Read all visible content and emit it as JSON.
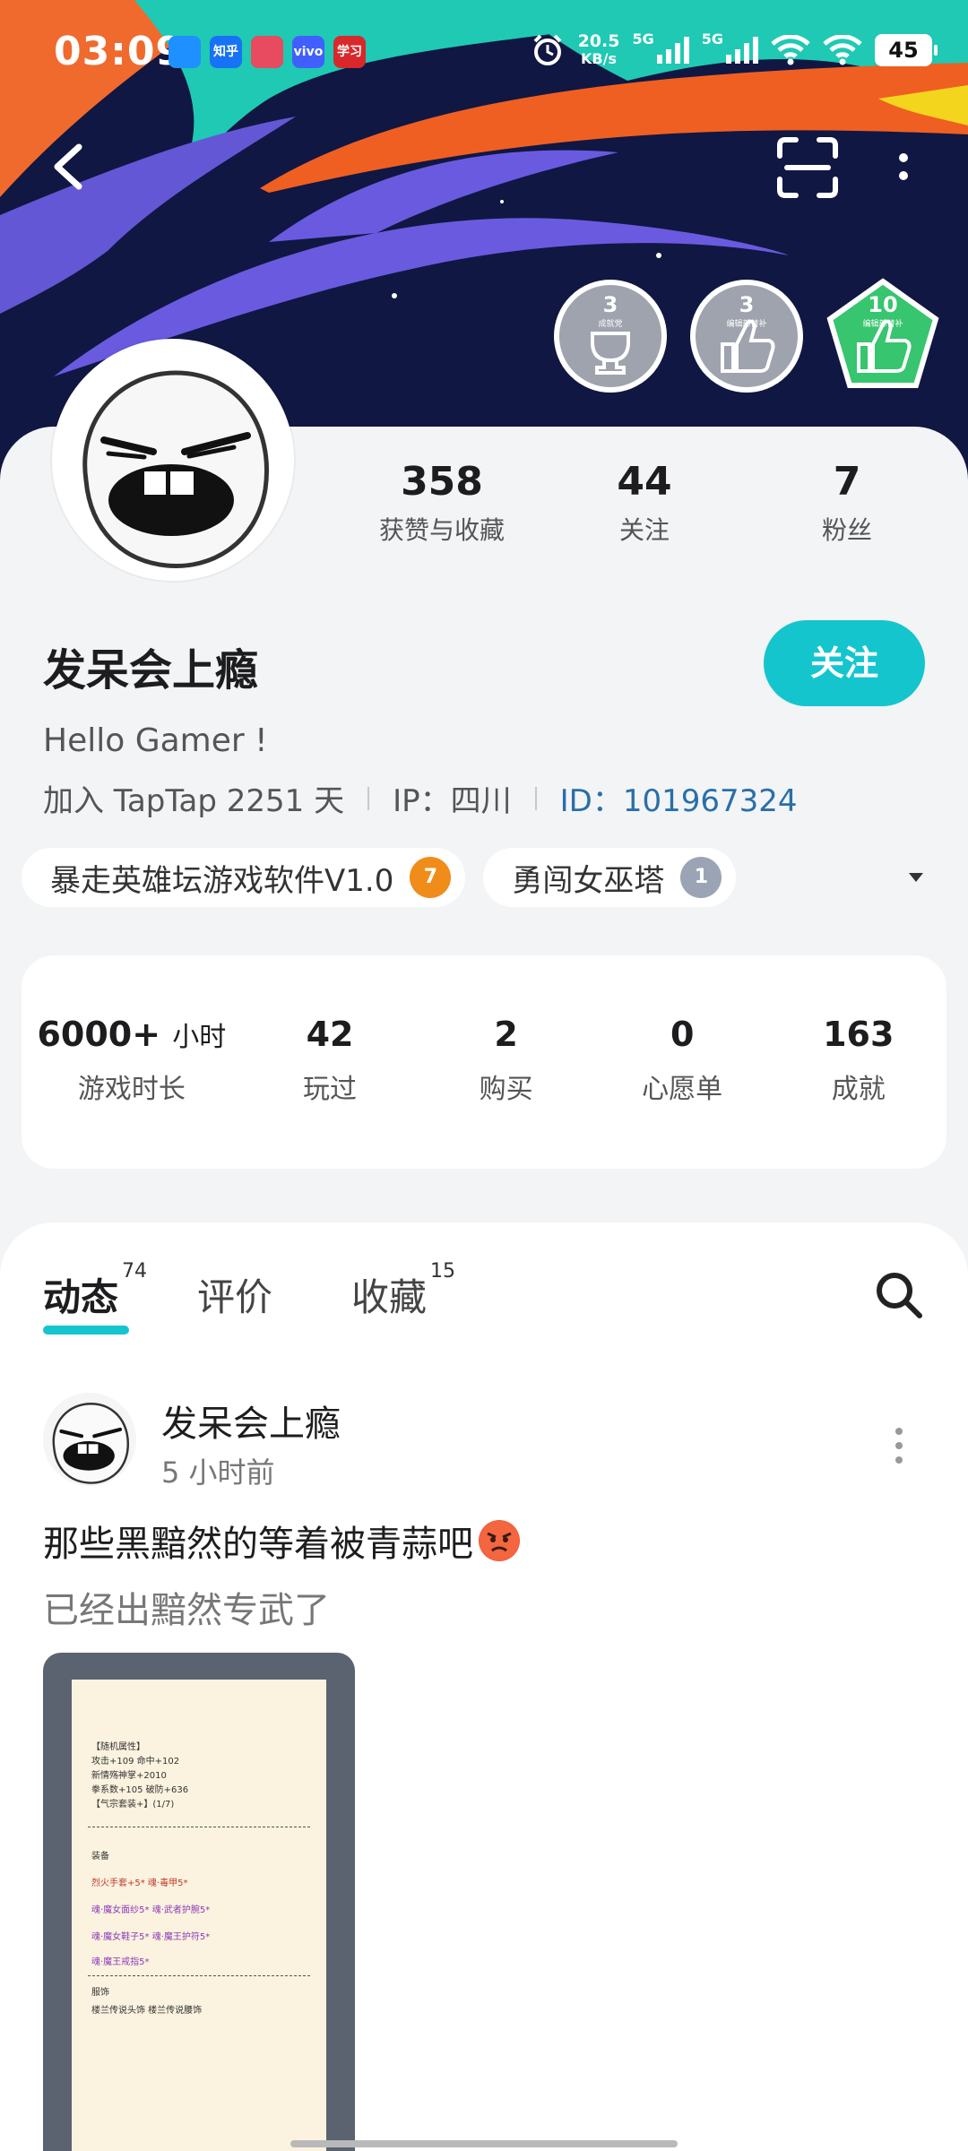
{
  "status_bar": {
    "time": "03:09",
    "app_icons": [
      {
        "name": "qq-icon",
        "text": "",
        "color": "#1e90ff"
      },
      {
        "name": "zhihu-icon",
        "text": "知乎",
        "color": "#1772f6"
      },
      {
        "name": "map-pin-app-icon",
        "text": "",
        "color": "#e84a5f"
      },
      {
        "name": "vivo-icon",
        "text": "vivo",
        "color": "#415fff"
      },
      {
        "name": "xuexi-icon",
        "text": "学习",
        "color": "#d8282b"
      }
    ],
    "net_speed": "20.5",
    "net_speed_unit": "KB/s",
    "signal1_label": "5G",
    "signal2_label": "5G",
    "battery": "45"
  },
  "badges": [
    {
      "count": "3",
      "label": "成就党",
      "color": "#9ea3ad"
    },
    {
      "count": "3",
      "label": "编辑部替补",
      "color": "#9ea3ad"
    },
    {
      "count": "10",
      "label": "编辑部替补",
      "color": "#37c56f"
    }
  ],
  "profile": {
    "stats": [
      {
        "value": "358",
        "label": "获赞与收藏"
      },
      {
        "value": "44",
        "label": "关注"
      },
      {
        "value": "7",
        "label": "粉丝"
      }
    ],
    "username": "发呆会上瘾",
    "follow_label": "关注",
    "bio": "Hello Gamer !",
    "join_text": "加入 TapTap 2251 天",
    "ip_text": "IP：四川",
    "id_text": "ID：101967324",
    "game_tags": [
      {
        "name": "暴走英雄坛游戏软件V1.0",
        "badge": "7",
        "badge_color": "#f08c1a"
      },
      {
        "name": "勇闯女巫塔",
        "badge": "1",
        "badge_color": "#9aa4b4"
      }
    ]
  },
  "game_stats": [
    {
      "value": "6000+",
      "unit": "小时",
      "label": "游戏时长"
    },
    {
      "value": "42",
      "unit": "",
      "label": "玩过"
    },
    {
      "value": "2",
      "unit": "",
      "label": "购买"
    },
    {
      "value": "0",
      "unit": "",
      "label": "心愿单"
    },
    {
      "value": "163",
      "unit": "",
      "label": "成就"
    }
  ],
  "tabs": [
    {
      "label": "动态",
      "count": "74",
      "active": true
    },
    {
      "label": "评价",
      "count": "",
      "active": false
    },
    {
      "label": "收藏",
      "count": "15",
      "active": false
    }
  ],
  "post": {
    "author": "发呆会上瘾",
    "time": "5 小时前",
    "title": "那些黑黯然的等着被青蒜吧",
    "subtitle": "已经出黯然专武了",
    "image_lines": [
      {
        "text": "【随机属性】",
        "cls": ""
      },
      {
        "text": "攻击+109 命中+102",
        "cls": ""
      },
      {
        "text": "新情殇神掌+2010",
        "cls": ""
      },
      {
        "text": "拳系数+105 破防+636",
        "cls": ""
      },
      {
        "text": "【气宗套装+】(1/7)",
        "cls": ""
      },
      {
        "text": "装备",
        "cls": ""
      },
      {
        "text": "烈火手套+5*        魂·毒甲5*",
        "cls": "red"
      },
      {
        "text": "魂·魔女面纱5*      魂·武者护腕5*",
        "cls": "purple"
      },
      {
        "text": "魂·魔女鞋子5*      魂·魔王护符5*",
        "cls": "purple"
      },
      {
        "text": "魂·魔王戒指5*",
        "cls": "purple"
      },
      {
        "text": "服饰",
        "cls": ""
      },
      {
        "text": "楼兰传说头饰       楼兰传说腰饰",
        "cls": ""
      }
    ]
  }
}
